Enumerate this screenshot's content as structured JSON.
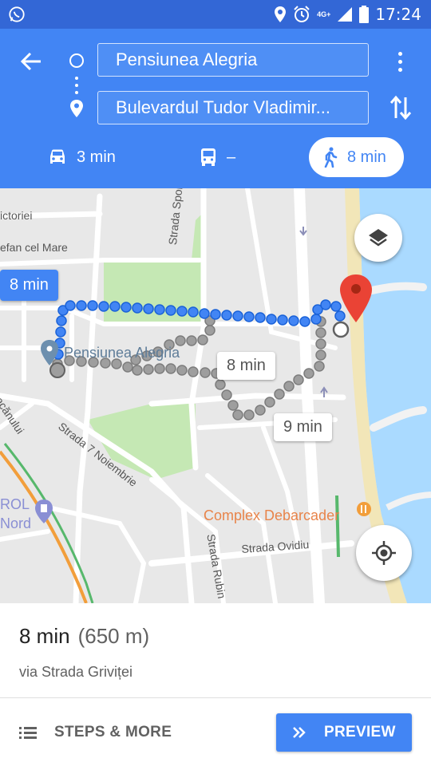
{
  "status_bar": {
    "time": "17:24",
    "network": "4G+",
    "icons": [
      "whatsapp-icon",
      "location-icon",
      "alarm-icon",
      "signal-icon",
      "battery-icon"
    ]
  },
  "header": {
    "start": "Pensiunea Alegria",
    "destination": "Bulevardul Tudor Vladimir...",
    "modes": [
      {
        "name": "drive",
        "icon": "car-icon",
        "label": "3 min"
      },
      {
        "name": "transit",
        "icon": "bus-icon",
        "label": "–"
      },
      {
        "name": "walk",
        "icon": "walk-icon",
        "label": "8 min",
        "selected": true
      }
    ]
  },
  "map": {
    "street_labels": {
      "victoriei": "ictoriei",
      "stefan": "efan cel Mare",
      "sportului": "Strada Sportului",
      "macanului": "eacănului",
      "noiembrie": "Strada 7 Noiembrie",
      "rol": "ROL",
      "nord": "Nord",
      "rubin": "Strada Rubin",
      "ovidiu": "Strada Ovidiu"
    },
    "places": {
      "origin": "Pensiunea Alegria",
      "poi": "Complex Debarcader"
    },
    "route_times": {
      "main": "8 min",
      "alt1": "8 min",
      "alt2": "9 min"
    }
  },
  "sheet": {
    "duration": "8 min",
    "distance": "(650 m)",
    "via": "via Strada Griviței",
    "steps_label": "STEPS & MORE",
    "preview_label": "PREVIEW"
  },
  "colors": {
    "header": "#4285f4",
    "status_bar": "#3367d6",
    "route_primary": "#4285f4",
    "route_alt": "#9e9e9e",
    "destination_pin": "#ea4335",
    "water": "#aadaff",
    "park": "#c5e8b4"
  }
}
